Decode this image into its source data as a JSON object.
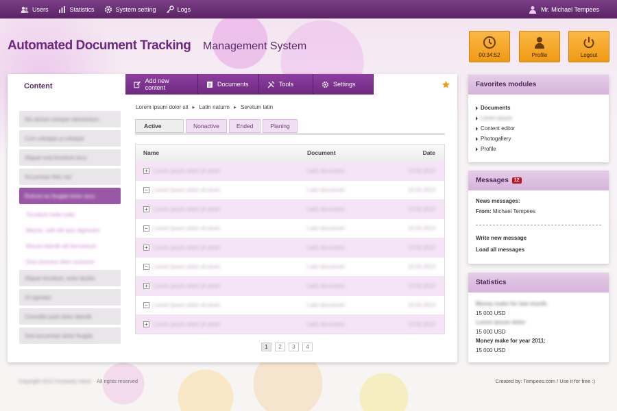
{
  "topbar": {
    "nav": [
      {
        "label": "Users",
        "icon": "users-icon"
      },
      {
        "label": "Statistics",
        "icon": "bar-chart-icon"
      },
      {
        "label": "System setting",
        "icon": "gear-icon"
      },
      {
        "label": "Logs",
        "icon": "key-icon"
      }
    ],
    "user_name": "Mr. Michael Tempees"
  },
  "header": {
    "title": "Automated Document Tracking",
    "subtitle": "Management System",
    "buttons": {
      "timer_label": "00:34:52",
      "profile_label": "Profile",
      "logout_label": "Logout"
    }
  },
  "content_panel": {
    "title": "Content",
    "tabs": [
      {
        "label": "Add new content",
        "icon": "edit-icon"
      },
      {
        "label": "Documents",
        "icon": "document-icon"
      },
      {
        "label": "Tools",
        "icon": "tools-icon"
      },
      {
        "label": "Settings",
        "icon": "gear-icon"
      }
    ],
    "left_menu": [
      "Nis dictum semper elementum",
      "Cum volutpat ut volutpat",
      "Aliquet erat tincidunt arcu",
      "Accumsan felis nisi",
      "Rutrum eu feugiat tortor arcu",
      "Magna tempus tortor dolor",
      "Vel agenta"
    ],
    "left_submenu": [
      "Tincidunt nulla nulla",
      "Mauris, velit elit quis dignissim",
      "Mauris blandit elit fermentum",
      "Duis posuere diam euismod"
    ],
    "left_menu_bottom": [
      "Aliquet tincidunt, enim facilisi",
      "Ut egestas",
      "Convallis justo dolor blandit",
      "Sed accumsan dolor feugiat"
    ],
    "breadcrumb": [
      "Lorem ipsum dolor sit",
      "Latin naturm",
      "Seretum latin"
    ],
    "subtabs": [
      "Active",
      "Nonactive",
      "Ended",
      "Planing"
    ],
    "table": {
      "headers": {
        "name": "Name",
        "document": "Document",
        "date": "Date"
      },
      "rows": [
        {
          "toggle": "+",
          "name": "Lorem ipsum dolor sit amet",
          "document": "Latin document",
          "date": "13.02.2013"
        },
        {
          "toggle": "−",
          "name": "Lorem ipsum dolor sit amet",
          "document": "Latin document",
          "date": "13.02.2013"
        },
        {
          "toggle": "+",
          "name": "Lorem ipsum dolor sit amet",
          "document": "Latin document",
          "date": "13.02.2013"
        },
        {
          "toggle": "−",
          "name": "Lorem ipsum dolor sit amet",
          "document": "Latin document",
          "date": "13.02.2013"
        },
        {
          "toggle": "+",
          "name": "Lorem ipsum dolor sit amet",
          "document": "Latin document",
          "date": "13.02.2013"
        },
        {
          "toggle": "−",
          "name": "Lorem ipsum dolor sit amet",
          "document": "Latin document",
          "date": "13.02.2013"
        },
        {
          "toggle": "+",
          "name": "Lorem ipsum dolor sit amet",
          "document": "Latin document",
          "date": "13.02.2013"
        },
        {
          "toggle": "−",
          "name": "Lorem ipsum dolor sit amet",
          "document": "Latin document",
          "date": "13.02.2013"
        },
        {
          "toggle": "+",
          "name": "Lorem ipsum dolor sit amet",
          "document": "Latin document",
          "date": "13.02.2013"
        }
      ]
    },
    "pages": [
      "1",
      "2",
      "3",
      "4"
    ]
  },
  "favorites": {
    "title": "Favorites modules",
    "items": [
      "Documents",
      "Lorem ipsum",
      "Content editor",
      "Photogallery",
      "Profile"
    ]
  },
  "messages": {
    "title": "Messages",
    "badge": "12",
    "news_label": "News messages:",
    "from_label": "From:",
    "from_value": "Michael Tempees",
    "write_link": "Write new message",
    "load_link": "Load all messages"
  },
  "statistics": {
    "title": "Statistics",
    "line1_label": "Money make for last month",
    "line1_value": "15 000 USD",
    "line2_label": "Lorem ipsum dolor",
    "line2_value": "15 000 USD",
    "line3_label": "Money make for year 2011:",
    "line3_value": "15 000 USD"
  },
  "footer": {
    "copyright": "Copyright 2012 Company name",
    "rights": "· All rights reserved",
    "credits": "Created by: Tempees.com / Use it for free :)"
  },
  "colors": {
    "topbar": "#5a2365",
    "accent_purple": "#7b3494",
    "orange_button": "#f5a623",
    "row_highlight": "#f5e4f6",
    "badge_red": "#c0141c"
  }
}
